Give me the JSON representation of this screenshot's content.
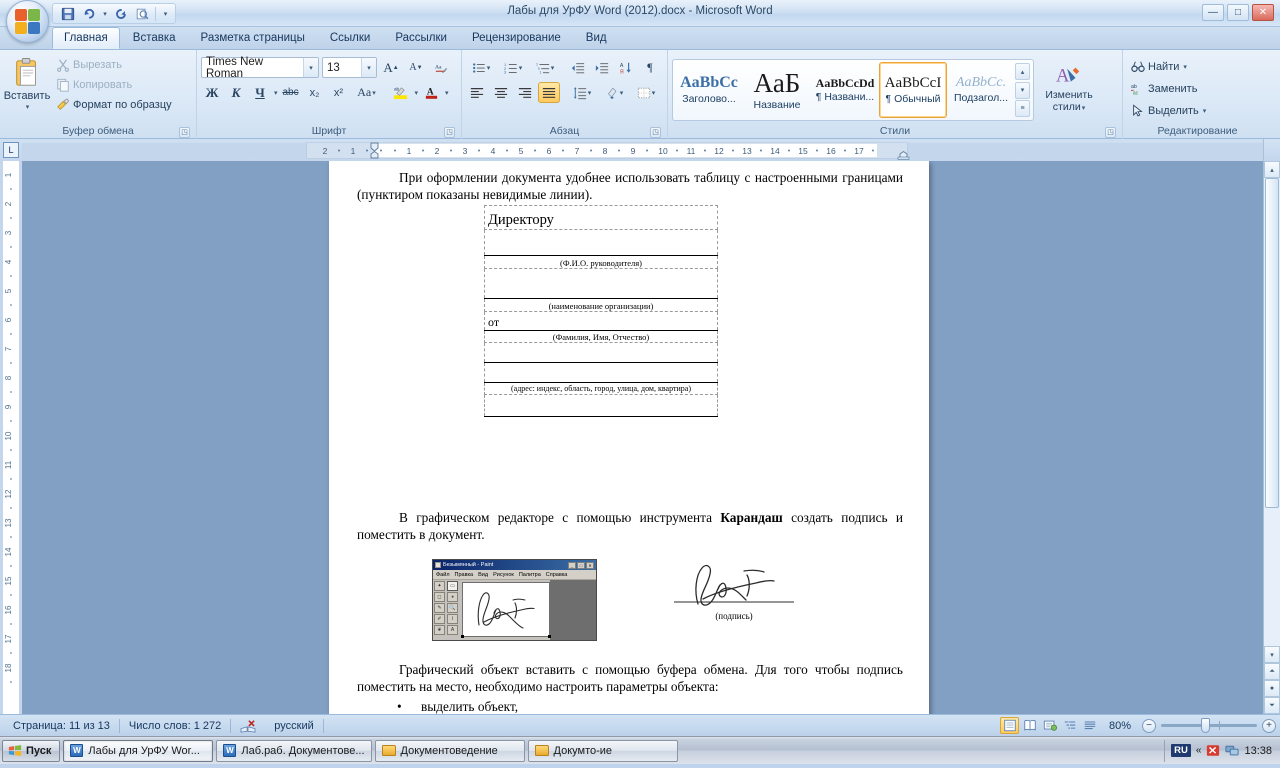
{
  "window": {
    "title": "Лабы для УрФУ Word (2012).docx - Microsoft Word",
    "minimize": "—",
    "maximize": "□",
    "close": "✕"
  },
  "quick_access": {
    "save": "save-icon",
    "undo": "undo-icon",
    "redo": "redo-icon",
    "print_preview": "print-preview-icon",
    "customize": "▾"
  },
  "tabs": [
    {
      "label": "Главная",
      "active": true
    },
    {
      "label": "Вставка",
      "active": false
    },
    {
      "label": "Разметка страницы",
      "active": false
    },
    {
      "label": "Ссылки",
      "active": false
    },
    {
      "label": "Рассылки",
      "active": false
    },
    {
      "label": "Рецензирование",
      "active": false
    },
    {
      "label": "Вид",
      "active": false
    }
  ],
  "ribbon": {
    "clipboard": {
      "label": "Буфер обмена",
      "paste": "Вставить",
      "paste_caret": "▾",
      "cut": "Вырезать",
      "copy": "Копировать",
      "format_painter": "Формат по образцу",
      "launcher": "◳"
    },
    "font": {
      "label": "Шрифт",
      "font_family": "Times New Roman",
      "font_size": "13",
      "grow_font": "A",
      "shrink_font": "A",
      "clear_formatting": "Aa",
      "bold": "Ж",
      "italic": "К",
      "underline": "Ч",
      "underline_caret": "▾",
      "strikethrough": "abc",
      "subscript": "x₂",
      "superscript": "x²",
      "change_case": "Aa",
      "highlight": "ab",
      "font_color": "A",
      "launcher": "◳"
    },
    "paragraph": {
      "label": "Абзац",
      "bullets": "≔",
      "numbering": "≕",
      "multilevel": "≖",
      "decrease_indent": "⇤",
      "increase_indent": "⇥",
      "sort": "A↓",
      "show_marks": "¶",
      "align_left": "≡",
      "align_center": "≡",
      "align_right": "≡",
      "align_justify": "≡",
      "line_spacing": "↕",
      "shading": "▨",
      "borders": "▦",
      "launcher": "◳"
    },
    "styles": {
      "label": "Стили",
      "items": [
        {
          "preview": "AaBbCc",
          "name": "Заголово...",
          "selected": false,
          "preview_style": "heading"
        },
        {
          "preview": "АаБ",
          "name": "Название",
          "selected": false,
          "preview_style": "title"
        },
        {
          "preview": "AaBbCcDd",
          "name": "¶ Названи...",
          "selected": false,
          "preview_style": "subtitle"
        },
        {
          "preview": "AaBbCcI",
          "name": "¶ Обычный",
          "selected": true,
          "preview_style": "normal"
        },
        {
          "preview": "AaBbCc.",
          "name": "Подзагол...",
          "selected": false,
          "preview_style": "light"
        }
      ],
      "change_styles": "Изменить",
      "change_styles2": "стили",
      "change_styles_caret": "▾",
      "scroll_up": "▴",
      "scroll_down": "▾",
      "scroll_more": "≡",
      "launcher": "◳"
    },
    "editing": {
      "label": "Редактирование",
      "find": "Найти",
      "find_caret": "▾",
      "replace": "Заменить",
      "select": "Выделить",
      "select_caret": "▾"
    }
  },
  "ruler": {
    "tab_selector": "L",
    "h_marks": [
      "2",
      "1",
      "1",
      "2",
      "3",
      "4",
      "5",
      "6",
      "7",
      "8",
      "9",
      "10",
      "11",
      "12",
      "13",
      "14",
      "15",
      "16",
      "17"
    ],
    "v_marks": [
      "1",
      "2",
      "3",
      "4",
      "5",
      "6",
      "7",
      "8",
      "9",
      "10",
      "11",
      "12",
      "13",
      "14",
      "15",
      "16",
      "17",
      "18"
    ]
  },
  "document": {
    "paragraph_1": "При оформлении документа удобнее использовать таблицу с настроенными границами (пунктиром показаны невидимые линии).",
    "table": {
      "row1": "Директору",
      "cap1": "(Ф.И.О. руководителя)",
      "cap2": "(наименование организации)",
      "row_from": "от",
      "cap3": "(Фамилия, Имя, Отчество)",
      "cap4": "(адрес: индекс, область, город, улица, дом, квартира)"
    },
    "paragraph_2_a": "В графическом редакторе с помощью инструмента ",
    "paragraph_2_bold": "Карандаш",
    "paragraph_2_b": " создать подпись и поместить в документ.",
    "paint_window": {
      "title": "Безымянный - Paint",
      "minimize": "_",
      "maximize": "□",
      "close": "✕",
      "menus": [
        "Файл",
        "Правка",
        "Вид",
        "Рисунок",
        "Палитра",
        "Справка"
      ]
    },
    "signature_caption": "(подпись)",
    "paragraph_3": "Графический объект вставить с помощью буфера обмена. Для того чтобы подпись поместить на место, необходимо настроить параметры объекта:",
    "bullet_1": "выделить объект,"
  },
  "status_bar": {
    "page": "Страница: 11 из 13",
    "words": "Число слов: 1 272",
    "language": "русский",
    "proofing_icon": "proofing-icon",
    "views": [
      {
        "name": "print-layout",
        "glyph": "▤",
        "active": true
      },
      {
        "name": "full-screen-reading",
        "glyph": "▥",
        "active": false
      },
      {
        "name": "web-layout",
        "glyph": "▦",
        "active": false
      },
      {
        "name": "outline",
        "glyph": "▨",
        "active": false
      },
      {
        "name": "draft",
        "glyph": "▤",
        "active": false
      }
    ],
    "zoom": "80%",
    "zoom_out": "−",
    "zoom_in": "+"
  },
  "taskbar": {
    "start": "Пуск",
    "items": [
      {
        "label": "Лабы для УрФУ Wor...",
        "icon": "word-icon",
        "active": true
      },
      {
        "label": "Лаб.раб. Документове...",
        "icon": "word-icon",
        "active": false
      },
      {
        "label": "Документоведение",
        "icon": "folder-icon",
        "active": false
      },
      {
        "label": "Докумто-ие",
        "icon": "folder-icon",
        "active": false
      }
    ],
    "tray": {
      "language": "RU",
      "expand": "«",
      "icon1": "antivirus-icon",
      "icon2": "network-icon",
      "clock": "13:38"
    }
  },
  "colors": {
    "accent": "#17365d",
    "ribbon_bg": "#dce9f7",
    "selected_style_border": "#e8a33d",
    "desktop": "#82a0c4"
  }
}
